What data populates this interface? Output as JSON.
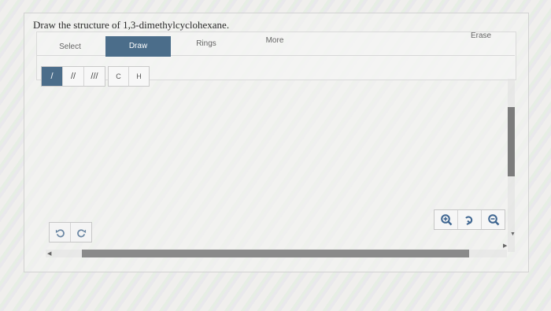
{
  "question": "Draw the structure of 1,3-dimethylcyclohexane.",
  "tabs": [
    {
      "label": "Select",
      "active": false
    },
    {
      "label": "Draw",
      "active": true
    },
    {
      "label": "Rings",
      "active": false
    },
    {
      "label": "More",
      "active": false
    }
  ],
  "erase_label": "Erase",
  "bonds": [
    {
      "label": "/",
      "name": "single-bond",
      "active": true
    },
    {
      "label": "//",
      "name": "double-bond",
      "active": false
    },
    {
      "label": "///",
      "name": "triple-bond",
      "active": false
    }
  ],
  "atoms": [
    {
      "label": "C",
      "name": "carbon"
    },
    {
      "label": "H",
      "name": "hydrogen"
    }
  ],
  "colors": {
    "accent": "#4b6d8a",
    "icon_blue": "#3f6691",
    "undo_blue": "#6a86a3"
  },
  "icons": [
    "undo-icon",
    "redo-icon",
    "zoom-in-icon",
    "reset-zoom-icon",
    "zoom-out-icon"
  ]
}
